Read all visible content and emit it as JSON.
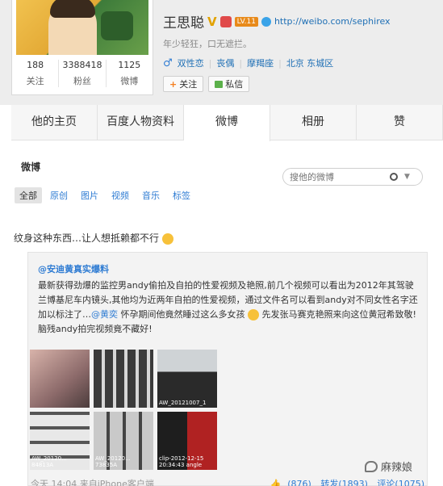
{
  "profile": {
    "name": "王思聪",
    "level_badge": "LV.11",
    "url": "http://weibo.com/sephirex",
    "motto": "年少轻狂，口无遮拦。",
    "tags": [
      "双性恋",
      "丧偶",
      "摩羯座",
      "北京 东城区"
    ],
    "stats": [
      {
        "value": "188",
        "label": "关注"
      },
      {
        "value": "3388418",
        "label": "粉丝"
      },
      {
        "value": "1125",
        "label": "微博"
      }
    ],
    "follow_label": "关注",
    "message_label": "私信"
  },
  "tabs": [
    "他的主页",
    "百度人物资料",
    "微博",
    "相册",
    "赞"
  ],
  "feed": {
    "title": "微博",
    "search_placeholder": "搜他的微博",
    "filters": [
      "全部",
      "原创",
      "图片",
      "视频",
      "音乐",
      "标签"
    ],
    "post_text": "纹身这种东西…让人想抵赖都不行",
    "repost": {
      "author": "@安迪黄真实爆料",
      "text_a": "最新获得劲爆的监控男andy偷拍及自拍的性爱视频及艳照,前几个视频可以看出为2012年其驾驶兰博基尼车内镜头,其他均为近两年自拍的性爱视频，通过文件名可以看到andy对不同女性名字还加以标注了…",
      "mention": "@黄奕",
      "text_b": " 怀孕期间他竟然睡过这么多女孩",
      "text_c": "先发张马赛克艳照来向这位黄冠希致敬!脑残andy拍完视频竟不藏好!",
      "thumb_labels": [
        "",
        "",
        "AW_20121007_1",
        "AW_20120... 84813A",
        "AW_20120... 73835A",
        "clip-2012-12-15 20:34:43 angle"
      ]
    },
    "footer": {
      "time": "今天 14:04",
      "source": "来自iPhone客户端",
      "likes": "(876)",
      "reposts": "转发(1893)",
      "comments": "评论(1075)"
    }
  },
  "watermark": "麻辣娘"
}
